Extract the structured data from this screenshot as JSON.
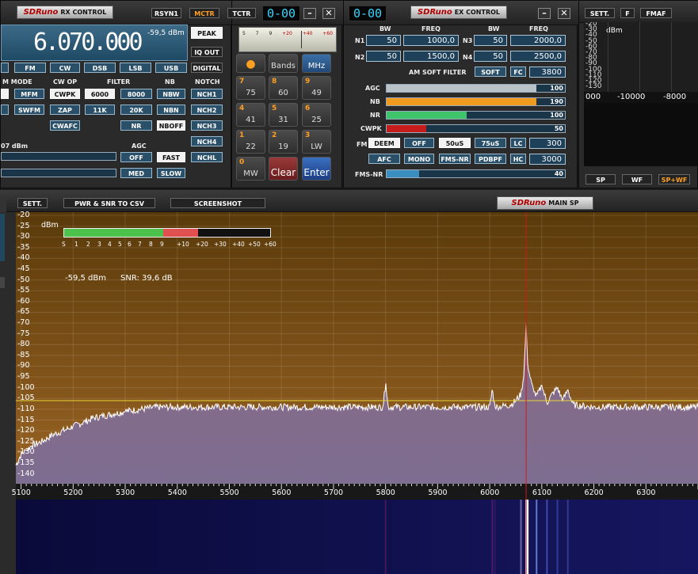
{
  "rx": {
    "logo_brand": "SDRuno",
    "logo_text": "RX CONTROL",
    "top_buttons": [
      "RSYN1",
      "MCTR",
      "TCTR"
    ],
    "clock": "0-00",
    "frequency": "6.070.000",
    "signal": "-59,5 dBm",
    "peak": "PEAK",
    "iq_out": "IQ OUT",
    "digital": "DIGITAL",
    "modes": [
      "FM",
      "CW",
      "DSB",
      "LSB",
      "USB"
    ],
    "section_labels": {
      "mode": "M MODE",
      "cwop": "CW OP",
      "filter": "FILTER",
      "nb": "NB",
      "notch": "NOTCH",
      "agc": "AGC"
    },
    "row1": {
      "mfm": "MFM",
      "cwpk": "CWPK",
      "f1": "6000",
      "f2": "8000",
      "nbw": "NBW",
      "nch1": "NCH1"
    },
    "row2": {
      "swfm": "SWFM",
      "zap": "ZAP",
      "f3": "11K",
      "f4": "20K",
      "nbn": "NBN",
      "nch2": "NCH2"
    },
    "row3": {
      "cwafc": "CWAFC",
      "nr": "NR",
      "nboff": "NBOFF",
      "nch3": "NCH3"
    },
    "nch4": "NCH4",
    "nchl": "NCHL",
    "dbm_partial": "07 dBm",
    "agc_buttons": [
      "OFF",
      "FAST",
      "MED",
      "SLOW"
    ]
  },
  "keypad": {
    "bands": "Bands",
    "mhz": "MHz",
    "scale_labels": [
      "5",
      "7",
      "9",
      "+20",
      "+40",
      "+60"
    ],
    "keys": [
      {
        "n": "7",
        "v": "75"
      },
      {
        "n": "8",
        "v": "60"
      },
      {
        "n": "9",
        "v": "49"
      },
      {
        "n": "4",
        "v": "41"
      },
      {
        "n": "5",
        "v": "31"
      },
      {
        "n": "6",
        "v": "25"
      },
      {
        "n": "1",
        "v": "22"
      },
      {
        "n": "2",
        "v": "19"
      },
      {
        "n": "3",
        "v": "LW"
      },
      {
        "n": "0",
        "v": "MW"
      }
    ],
    "clear": "Clear",
    "enter": "Enter"
  },
  "ex": {
    "clock": "0-00",
    "logo_brand": "SDRuno",
    "logo_text": "EX CONTROL",
    "headers": [
      "BW",
      "FREQ",
      "BW",
      "FREQ"
    ],
    "rows": [
      {
        "n1": "N1",
        "bw1": "50",
        "freq1": "1000,0",
        "n2": "N3",
        "bw2": "50",
        "freq2": "2000,0"
      },
      {
        "n1": "N2",
        "bw1": "50",
        "freq1": "1500,0",
        "n2": "N4",
        "bw2": "50",
        "freq2": "2500,0"
      }
    ],
    "am_soft": "AM SOFT FILTER",
    "soft": "SOFT",
    "fc": "FC",
    "fc_val": "3800",
    "bars": [
      {
        "label": "AGC",
        "value": "100",
        "frac": 0.84,
        "color": "#b8c2c8"
      },
      {
        "label": "NB",
        "value": "190",
        "frac": 0.84,
        "color": "#f09a1e"
      },
      {
        "label": "NR",
        "value": "100",
        "frac": 0.45,
        "color": "#3ec46a"
      },
      {
        "label": "CWPK",
        "value": "50",
        "frac": 0.22,
        "color": "#c61c1c"
      }
    ],
    "fm": "FM",
    "deem": "DEEM",
    "off": "OFF",
    "us50": "50uS",
    "us75": "75uS",
    "lc": "LC",
    "lc_val": "300",
    "afc": "AFC",
    "mono": "MONO",
    "fmsnr": "FMS-NR",
    "pdbpf": "PDBPF",
    "hc": "HC",
    "hc_val": "3000",
    "fmsnr_label": "FMS-NR",
    "fmsnr_value": "40",
    "fmsnr_frac": 0.18
  },
  "aux": {
    "sett": "SETT.",
    "f": "F",
    "fmaf": "FMAF",
    "dbm": "dBm",
    "ylabels": [
      "-20",
      "-30",
      "-40",
      "-50",
      "-60",
      "-70",
      "-80",
      "-90",
      "-100",
      "-110",
      "-120",
      "-130"
    ],
    "xlabels": [
      "000",
      "-10000",
      "-8000"
    ],
    "sp": "SP",
    "wf": "WF",
    "spwf": "SP+WF"
  },
  "main": {
    "sett": "SETT.",
    "csv": "PWR & SNR TO CSV",
    "screenshot": "SCREENSHOT",
    "logo_brand": "SDRuno",
    "logo_text": "MAIN SP",
    "dbm": "dBm",
    "level": "-59,5 dBm",
    "snr": "SNR: 39,6 dB",
    "s_labels": [
      "S",
      "1",
      "2",
      "3",
      "4",
      "5",
      "6",
      "7",
      "8",
      "9",
      "+10",
      "+20",
      "+30",
      "+40",
      "+50",
      "+60"
    ]
  },
  "chart_data": {
    "type": "line",
    "ylabels": [
      "-20",
      "-25",
      "-30",
      "-35",
      "-40",
      "-45",
      "-50",
      "-55",
      "-60",
      "-65",
      "-70",
      "-75",
      "-80",
      "-85",
      "-90",
      "-95",
      "-100",
      "-105",
      "-110",
      "-115",
      "-120",
      "-125",
      "-130",
      "-135",
      "-140"
    ],
    "xlabels": [
      "5100",
      "5200",
      "5300",
      "5400",
      "5500",
      "5600",
      "5700",
      "5800",
      "5900",
      "6000",
      "6100",
      "6200",
      "6300"
    ],
    "ylim": [
      -20,
      -142
    ],
    "xlim": [
      5090,
      6400
    ],
    "tuned": 6070,
    "squelch": -106,
    "x": [
      5090,
      5100,
      5110,
      5120,
      5140,
      5160,
      5180,
      5200,
      5220,
      5240,
      5260,
      5280,
      5300,
      5330,
      5360,
      5400,
      5500,
      5600,
      5700,
      5795,
      5800,
      5805,
      5900,
      5980,
      6000,
      6005,
      6010,
      6040,
      6050,
      6060,
      6065,
      6068,
      6070,
      6072,
      6075,
      6080,
      6085,
      6090,
      6100,
      6110,
      6120,
      6130,
      6140,
      6150,
      6160,
      6200,
      6300,
      6400
    ],
    "y": [
      -136,
      -131,
      -129,
      -127,
      -125,
      -122,
      -120,
      -118,
      -116,
      -114,
      -113,
      -112,
      -111,
      -110,
      -109,
      -109,
      -109,
      -109,
      -109,
      -109,
      -98,
      -109,
      -109,
      -109,
      -109,
      -101,
      -109,
      -108,
      -106,
      -103,
      -95,
      -82,
      -70,
      -86,
      -92,
      -98,
      -102,
      -104,
      -99,
      -107,
      -103,
      -100,
      -106,
      -101,
      -108,
      -109,
      -109,
      -109
    ]
  }
}
